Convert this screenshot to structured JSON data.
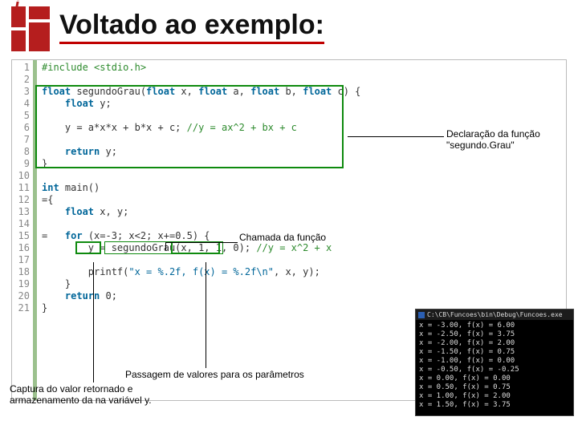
{
  "title": "Voltado ao exemplo:",
  "code": {
    "lines": [
      {
        "n": 1,
        "html": "<span class='dr'>#include &lt;stdio.h&gt;</span>"
      },
      {
        "n": 2,
        "html": ""
      },
      {
        "n": 3,
        "html": "<span class='kw'>float</span> segundoGrau(<span class='kw'>float</span> x, <span class='kw'>float</span> a, <span class='kw'>float</span> b, <span class='kw'>float</span> c) {"
      },
      {
        "n": 4,
        "html": "    <span class='kw'>float</span> y;"
      },
      {
        "n": 5,
        "html": ""
      },
      {
        "n": 6,
        "html": "    y = a*x*x + b*x + c; <span class='dr'>//y = ax^2 + bx + c</span>"
      },
      {
        "n": 7,
        "html": ""
      },
      {
        "n": 8,
        "html": "    <span class='kw'>return</span> y;"
      },
      {
        "n": 9,
        "html": "}"
      },
      {
        "n": 10,
        "html": ""
      },
      {
        "n": 11,
        "html": "<span class='kw'>int</span> main()"
      },
      {
        "n": 12,
        "html": "={"
      },
      {
        "n": 13,
        "html": "    <span class='kw'>float</span> x, y;"
      },
      {
        "n": 14,
        "html": ""
      },
      {
        "n": 15,
        "html": "=   <span class='kw'>for</span> (x=-3; x&lt;2; x+=0.5) {"
      },
      {
        "n": 16,
        "html": "        y = segundoGrau(x, 1, 1, 0); <span class='dr'>//y = x^2 + x</span>"
      },
      {
        "n": 17,
        "html": ""
      },
      {
        "n": 18,
        "html": "        printf(<span class='s'>\"x = %.2f, f(x) = %.2f\\n\"</span>, x, y);"
      },
      {
        "n": 19,
        "html": "    }"
      },
      {
        "n": 20,
        "html": "    <span class='kw'>return</span> 0;"
      },
      {
        "n": 21,
        "html": "}"
      }
    ]
  },
  "annotations": {
    "decl": "Declaração da função \"segundo.Grau\"",
    "call": "Chamada da função",
    "passagem": "Passagem de valores para os parâmetros",
    "captura": "Captura do valor retornado e armazenamento da na variável y."
  },
  "console": {
    "title": "C:\\CB\\Funcoes\\bin\\Debug\\Funcoes.exe",
    "rows": [
      "x = -3.00, f(x) = 6.00",
      "x = -2.50, f(x) = 3.75",
      "x = -2.00, f(x) = 2.00",
      "x = -1.50, f(x) = 0.75",
      "x = -1.00, f(x) = 0.00",
      "x = -0.50, f(x) = -0.25",
      "x =  0.00, f(x) = 0.00",
      "x =  0.50, f(x) = 0.75",
      "x =  1.00, f(x) = 2.00",
      "x =  1.50, f(x) = 3.75"
    ]
  }
}
